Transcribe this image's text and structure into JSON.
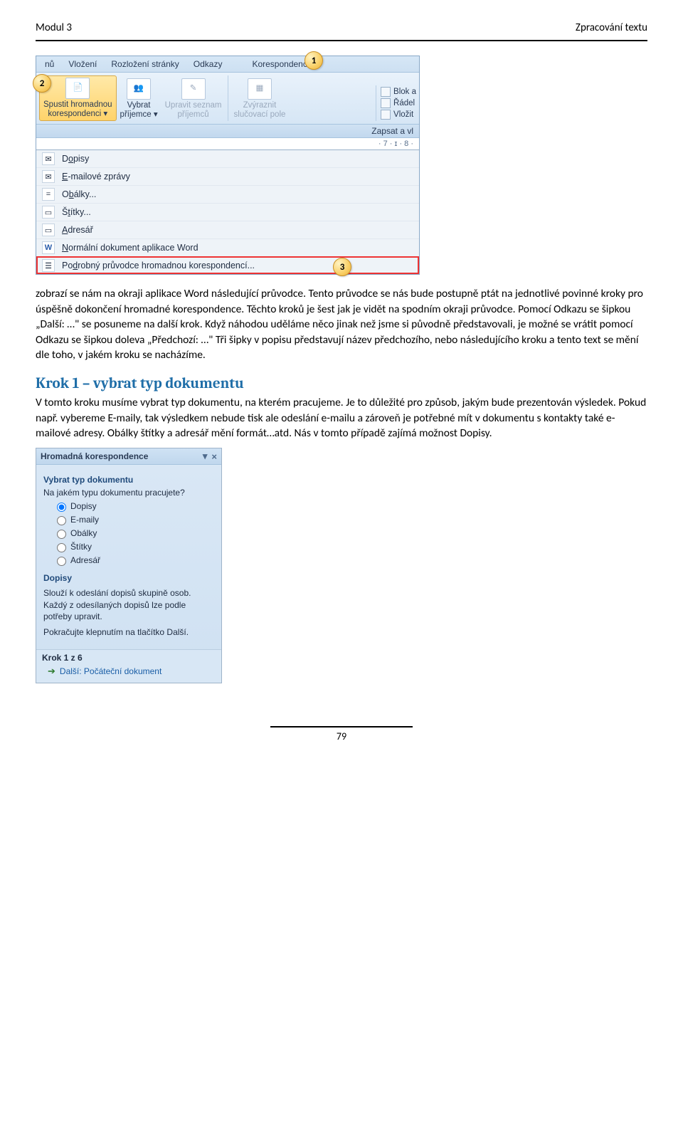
{
  "header": {
    "left": "Modul 3",
    "right": "Zpracování textu"
  },
  "callouts": {
    "c1": "1",
    "c2": "2",
    "c3": "3"
  },
  "ribbon": {
    "tabs": [
      "nů",
      "Vložení",
      "Rozložení stránky",
      "Odkazy",
      "Korespondence"
    ],
    "cmds": {
      "spustit": "Spustit hromadnou\nkorespondenci ▾",
      "vybrat": "Vybrat\npříjemce ▾",
      "upravit": "Upravit seznam\npříjemců",
      "zvyraznit": "Zvýraznit\nslučovací pole"
    },
    "right": {
      "blok": "Blok a",
      "radek": "Řádel",
      "vlozit": "Vložit"
    },
    "strip": "Zapsat a vl",
    "ruler": "· 7 · ɪ · 8 ·"
  },
  "dropdown": {
    "items": [
      {
        "icon": "✉",
        "label_pre": "D",
        "label_und": "o",
        "label_post": "pisy"
      },
      {
        "icon": "✉",
        "label_pre": "",
        "label_und": "E",
        "label_post": "-mailové zprávy"
      },
      {
        "icon": "=",
        "label_pre": "O",
        "label_und": "b",
        "label_post": "álky..."
      },
      {
        "icon": "▭",
        "label_pre": "Š",
        "label_und": "t",
        "label_post": "ítky..."
      },
      {
        "icon": "▭",
        "label_pre": "",
        "label_und": "A",
        "label_post": "dresář"
      },
      {
        "icon": "W",
        "label_pre": "",
        "label_und": "N",
        "label_post": "ormální dokument aplikace Word"
      },
      {
        "icon": "☰",
        "label_pre": "Po",
        "label_und": "d",
        "label_post": "robný průvodce hromadnou korespondencí..."
      }
    ]
  },
  "para1": "zobrazí se nám na okraji aplikace Word následující průvodce. Tento průvodce se nás bude postupně ptát na jednotlivé povinné kroky pro úspěšně dokončení hromadné korespondence. Těchto kroků je šest jak je vidět na spodním okraji průvodce. Pomocí Odkazu se šipkou „Další: …\" se posuneme na další krok. Když náhodou uděláme něco jinak než jsme si původně představovali, je možné se vrátit pomocí Odkazu se šipkou doleva „Předchozí: …\" Tři šipky v popisu představují název předchozího, nebo následujícího kroku a tento text se mění dle toho, v jakém kroku se nacházíme.",
  "step1_title": "Krok 1 – vybrat typ dokumentu",
  "para2": "V tomto kroku musíme vybrat typ dokumentu, na kterém pracujeme. Je to důležité pro způsob, jakým bude prezentován výsledek. Pokud např. vybereme E-maily, tak výsledkem nebude tisk ale odeslání e-mailu a zároveň je potřebné mít v dokumentu s kontakty také e-mailové adresy. Obálky štítky a adresář mění formát…atd. Nás v tomto případě zajímá možnost Dopisy.",
  "taskpane": {
    "title": "Hromadná korespondence",
    "section1": "Vybrat typ dokumentu",
    "question": "Na jakém typu dokumentu pracujete?",
    "options": [
      "Dopisy",
      "E-maily",
      "Obálky",
      "Štítky",
      "Adresář"
    ],
    "section2": "Dopisy",
    "desc1": "Slouží k odeslání dopisů skupině osob. Každý z odesílaných dopisů lze podle potřeby upravit.",
    "desc2": "Pokračujte klepnutím na tlačítko Další.",
    "step": "Krok 1 z 6",
    "next": "Další: Počáteční dokument"
  },
  "page_no": "79"
}
